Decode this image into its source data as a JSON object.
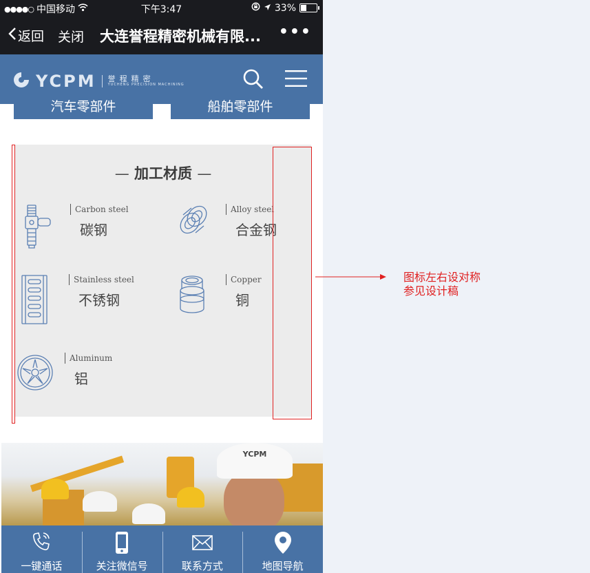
{
  "status_bar": {
    "carrier": "中国移动",
    "time": "下午3:47",
    "battery": "33%",
    "battery_level": 0.33
  },
  "nav": {
    "back_label": "返回",
    "close_label": "关闭",
    "title": "大连誉程精密机械有限...",
    "more_label": "•••"
  },
  "header": {
    "logo_text": "YCPM",
    "logo_cn": "誉程精密",
    "logo_en": "YUCHENG PRECISION MACHINING"
  },
  "categories": [
    "汽车零部件",
    "船舶零部件"
  ],
  "materials": {
    "title": "加工材质",
    "items": [
      {
        "en": "Carbon steel",
        "zh": "碳钢",
        "icon": "valve-icon"
      },
      {
        "en": "Alloy steel",
        "zh": "合金钢",
        "icon": "ring-roller-icon"
      },
      {
        "en": "Stainless steel",
        "zh": "不锈钢",
        "icon": "rack-icon"
      },
      {
        "en": "Copper",
        "zh": "铜",
        "icon": "bushing-icon"
      },
      {
        "en": "Aluminum",
        "zh": "铝",
        "icon": "wheel-icon"
      }
    ]
  },
  "annotation": {
    "line1": "图标左右设对称",
    "line2": "参见设计稿",
    "color": "#e02020"
  },
  "banner": {
    "helmet_logo": "YCPM"
  },
  "bottom_bar": [
    {
      "label": "一键通话",
      "icon": "phone-icon"
    },
    {
      "label": "关注微信号",
      "icon": "mobile-icon"
    },
    {
      "label": "联系方式",
      "icon": "mail-icon"
    },
    {
      "label": "地图导航",
      "icon": "map-pin-icon"
    }
  ],
  "colors": {
    "brand_blue": "#4872a5",
    "nav_dark": "#1a1b1f",
    "section_bg": "#ececec"
  }
}
